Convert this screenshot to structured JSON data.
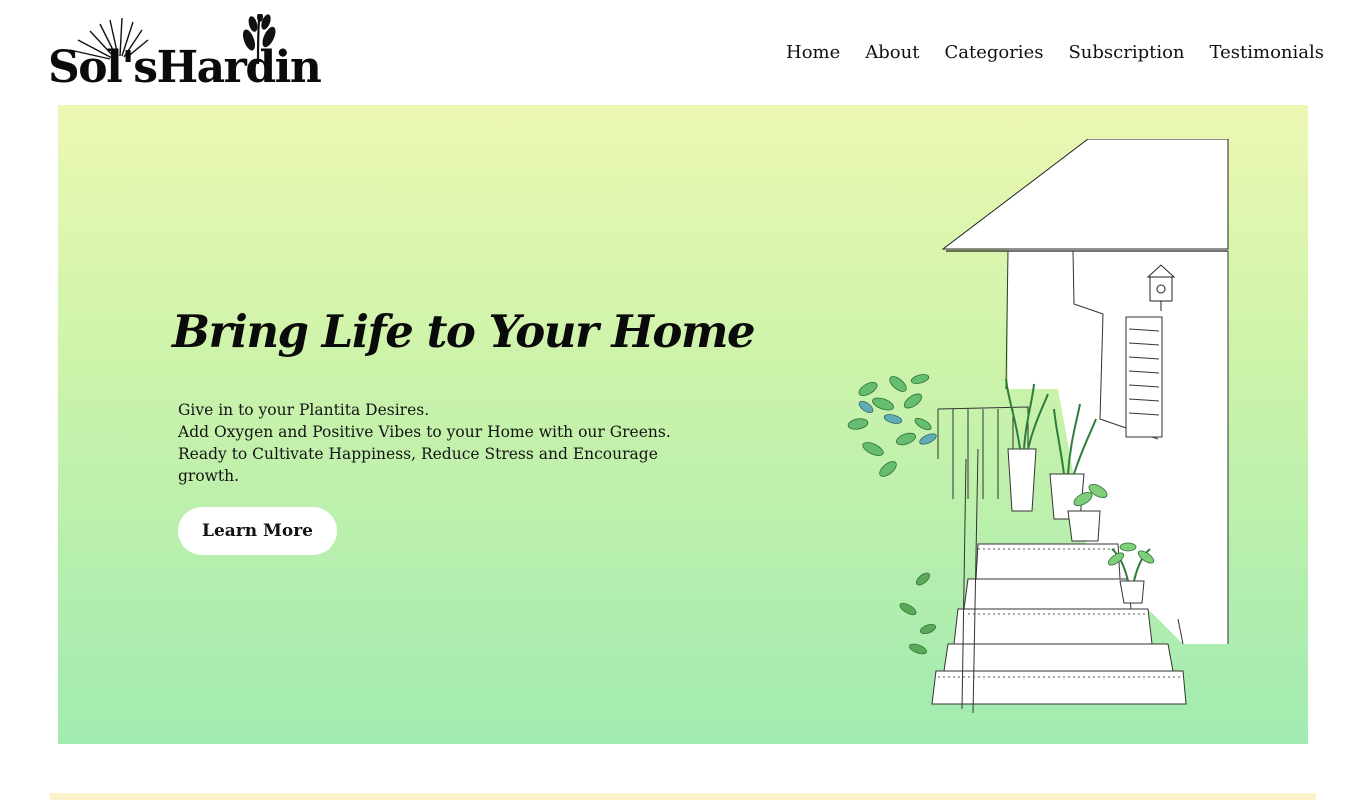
{
  "brand": {
    "name": "Sol'sHardin"
  },
  "nav": {
    "items": [
      {
        "label": "Home"
      },
      {
        "label": "About"
      },
      {
        "label": "Categories"
      },
      {
        "label": "Subscription"
      },
      {
        "label": "Testimonials"
      }
    ]
  },
  "hero": {
    "title": "Bring Life to Your Home",
    "lines": [
      "Give in to your Plantita Desires.",
      "Add Oxygen and Positive Vibes to your Home with our Greens.",
      "Ready to Cultivate Happiness, Reduce Stress and Encourage growth."
    ],
    "cta_label": "Learn More"
  },
  "colors": {
    "gradient_top": "#ecf8b3",
    "gradient_bottom": "#a1ebb1",
    "next_section_bg": "#fbf2c8"
  },
  "icons": {
    "logo_mark": "sun-and-leaves-icon",
    "hero_art": "house-steps-with-plants-sketch"
  }
}
